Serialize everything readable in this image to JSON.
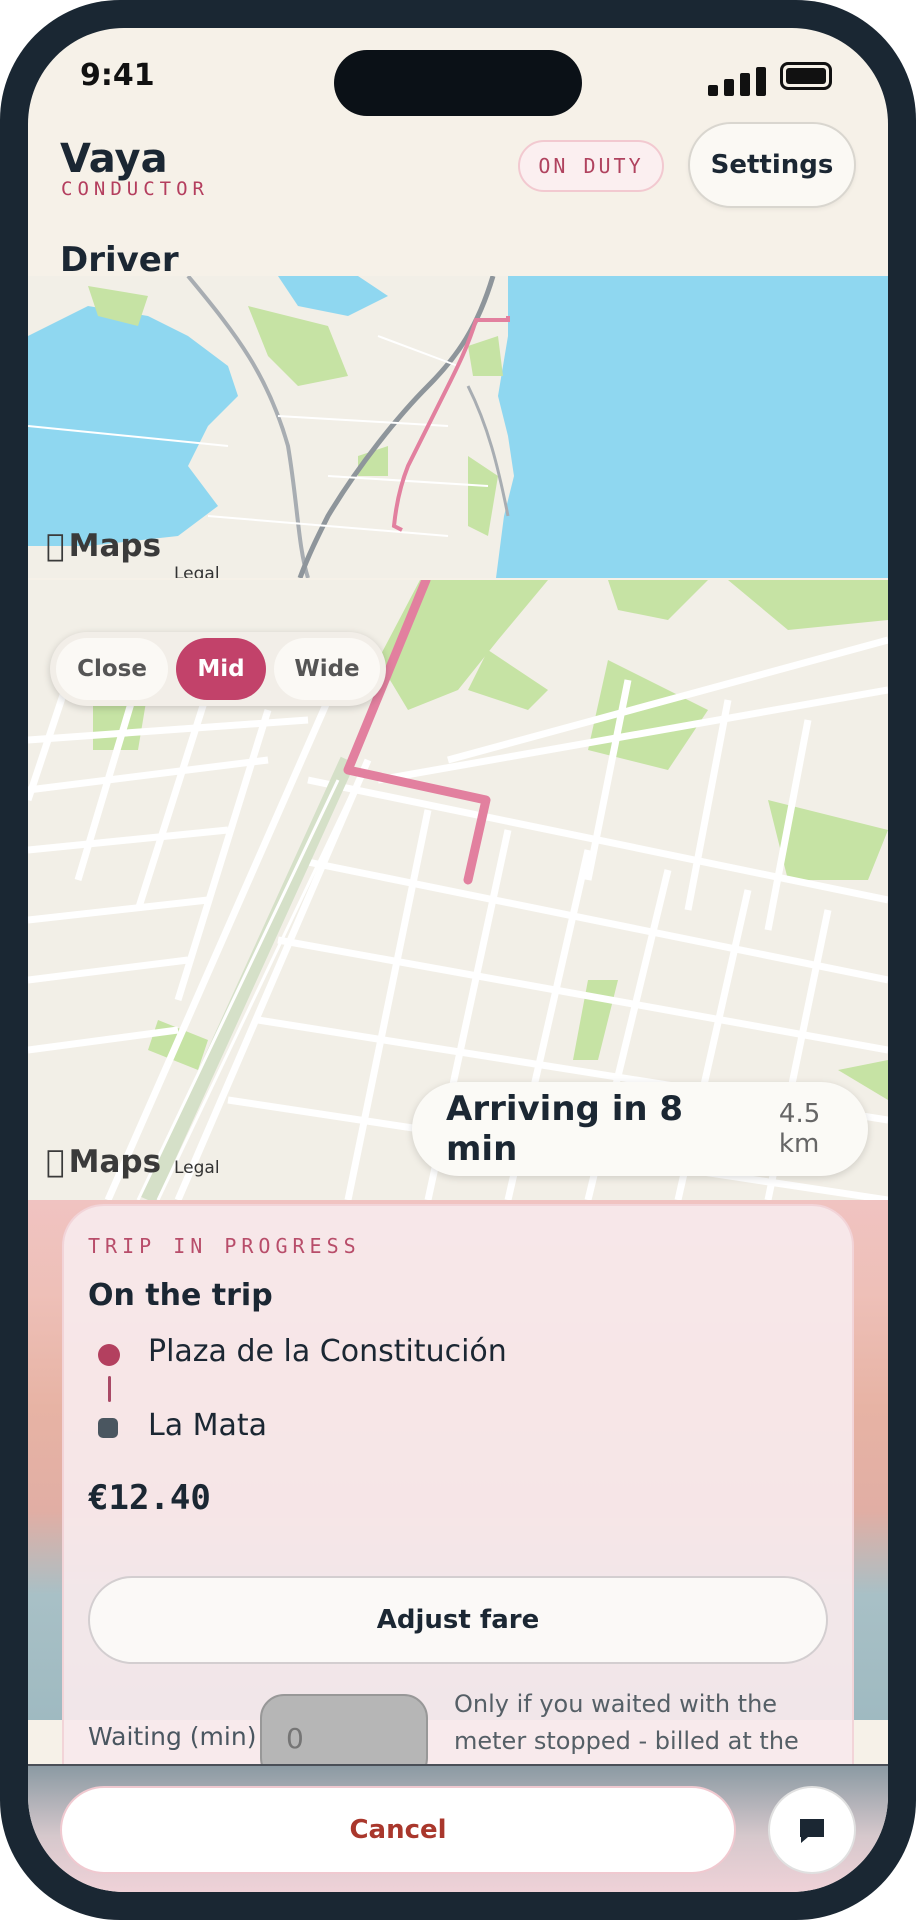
{
  "status_bar": {
    "time": "9:41"
  },
  "header": {
    "brand": "Vaya",
    "brand_sub": "CONDUCTOR",
    "duty_badge": "ON DUTY",
    "settings_label": "Settings"
  },
  "section_title": "Driver",
  "maps": {
    "logo_text": "Maps",
    "legal_text": "Legal"
  },
  "zoom": {
    "options": [
      "Close",
      "Mid",
      "Wide"
    ],
    "selected": "Mid"
  },
  "eta": {
    "text": "Arriving in 8 min",
    "distance": "4.5 km"
  },
  "trip": {
    "kicker": "TRIP IN PROGRESS",
    "title": "On the trip",
    "from": "Plaza de la Constitución",
    "to": "La Mata",
    "fare": "€12.40",
    "adjust_label": "Adjust fare",
    "waiting_label": "Waiting (min)",
    "waiting_placeholder": "0",
    "waiting_note": "Only if you waited with the meter stopped - billed at the waiting rate."
  },
  "bottom": {
    "cancel_label": "Cancel"
  },
  "colors": {
    "accent": "#c2426a",
    "water": "#8fd7f0",
    "park": "#c6e3a4",
    "land": "#f2efe7",
    "route": "#e2809f",
    "cancel_text": "#a9372c"
  }
}
